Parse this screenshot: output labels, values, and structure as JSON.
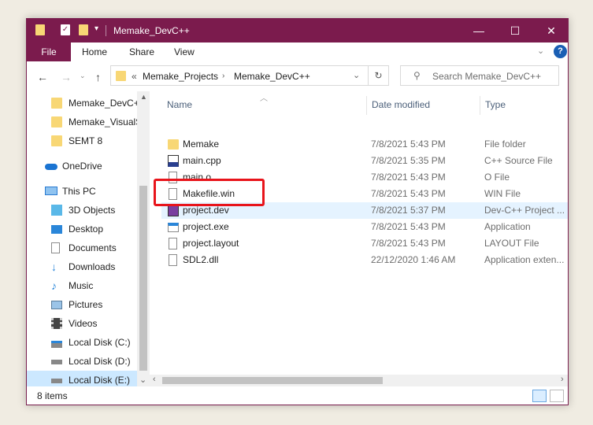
{
  "window": {
    "title": "Memake_DevC++",
    "controls": {
      "minimize": "—",
      "maximize": "☐",
      "close": "✕"
    }
  },
  "ribbon": {
    "file": "File",
    "tabs": [
      "Home",
      "Share",
      "View"
    ],
    "help": "?"
  },
  "address": {
    "prefix": "«",
    "crumbs": [
      "Memake_Projects",
      "Memake_DevC++"
    ],
    "search_placeholder": "Search Memake_DevC++"
  },
  "nav": {
    "quick": [
      "Memake_DevC++",
      "Memake_VisualS",
      "SEMT 8"
    ],
    "onedrive": "OneDrive",
    "thispc": "This PC",
    "pc_items": [
      "3D Objects",
      "Desktop",
      "Documents",
      "Downloads",
      "Music",
      "Pictures",
      "Videos",
      "Local Disk (C:)",
      "Local Disk (D:)",
      "Local Disk (E:)"
    ]
  },
  "columns": {
    "name": "Name",
    "date": "Date modified",
    "type": "Type"
  },
  "files": [
    {
      "name": "Memake",
      "date": "7/8/2021 5:43 PM",
      "type": "File folder",
      "icon": "folder-icon"
    },
    {
      "name": "main.cpp",
      "date": "7/8/2021 5:35 PM",
      "type": "C++ Source File",
      "icon": "cpp-file-icon"
    },
    {
      "name": "main.o",
      "date": "7/8/2021 5:43 PM",
      "type": "O File",
      "icon": "file-icon"
    },
    {
      "name": "Makefile.win",
      "date": "7/8/2021 5:43 PM",
      "type": "WIN File",
      "icon": "file-icon"
    },
    {
      "name": "project.dev",
      "date": "7/8/2021 5:37 PM",
      "type": "Dev-C++ Project ...",
      "icon": "devcpp-project-icon"
    },
    {
      "name": "project.exe",
      "date": "7/8/2021 5:43 PM",
      "type": "Application",
      "icon": "exe-icon"
    },
    {
      "name": "project.layout",
      "date": "7/8/2021 5:43 PM",
      "type": "LAYOUT File",
      "icon": "file-icon"
    },
    {
      "name": "SDL2.dll",
      "date": "22/12/2020 1:46 AM",
      "type": "Application exten...",
      "icon": "dll-icon"
    }
  ],
  "status": {
    "count": "8 items"
  },
  "colors": {
    "titlebar": "#7b1b4d",
    "highlight": "#e8141b",
    "selection": "#cce8ff",
    "hover": "#e5f3ff"
  }
}
